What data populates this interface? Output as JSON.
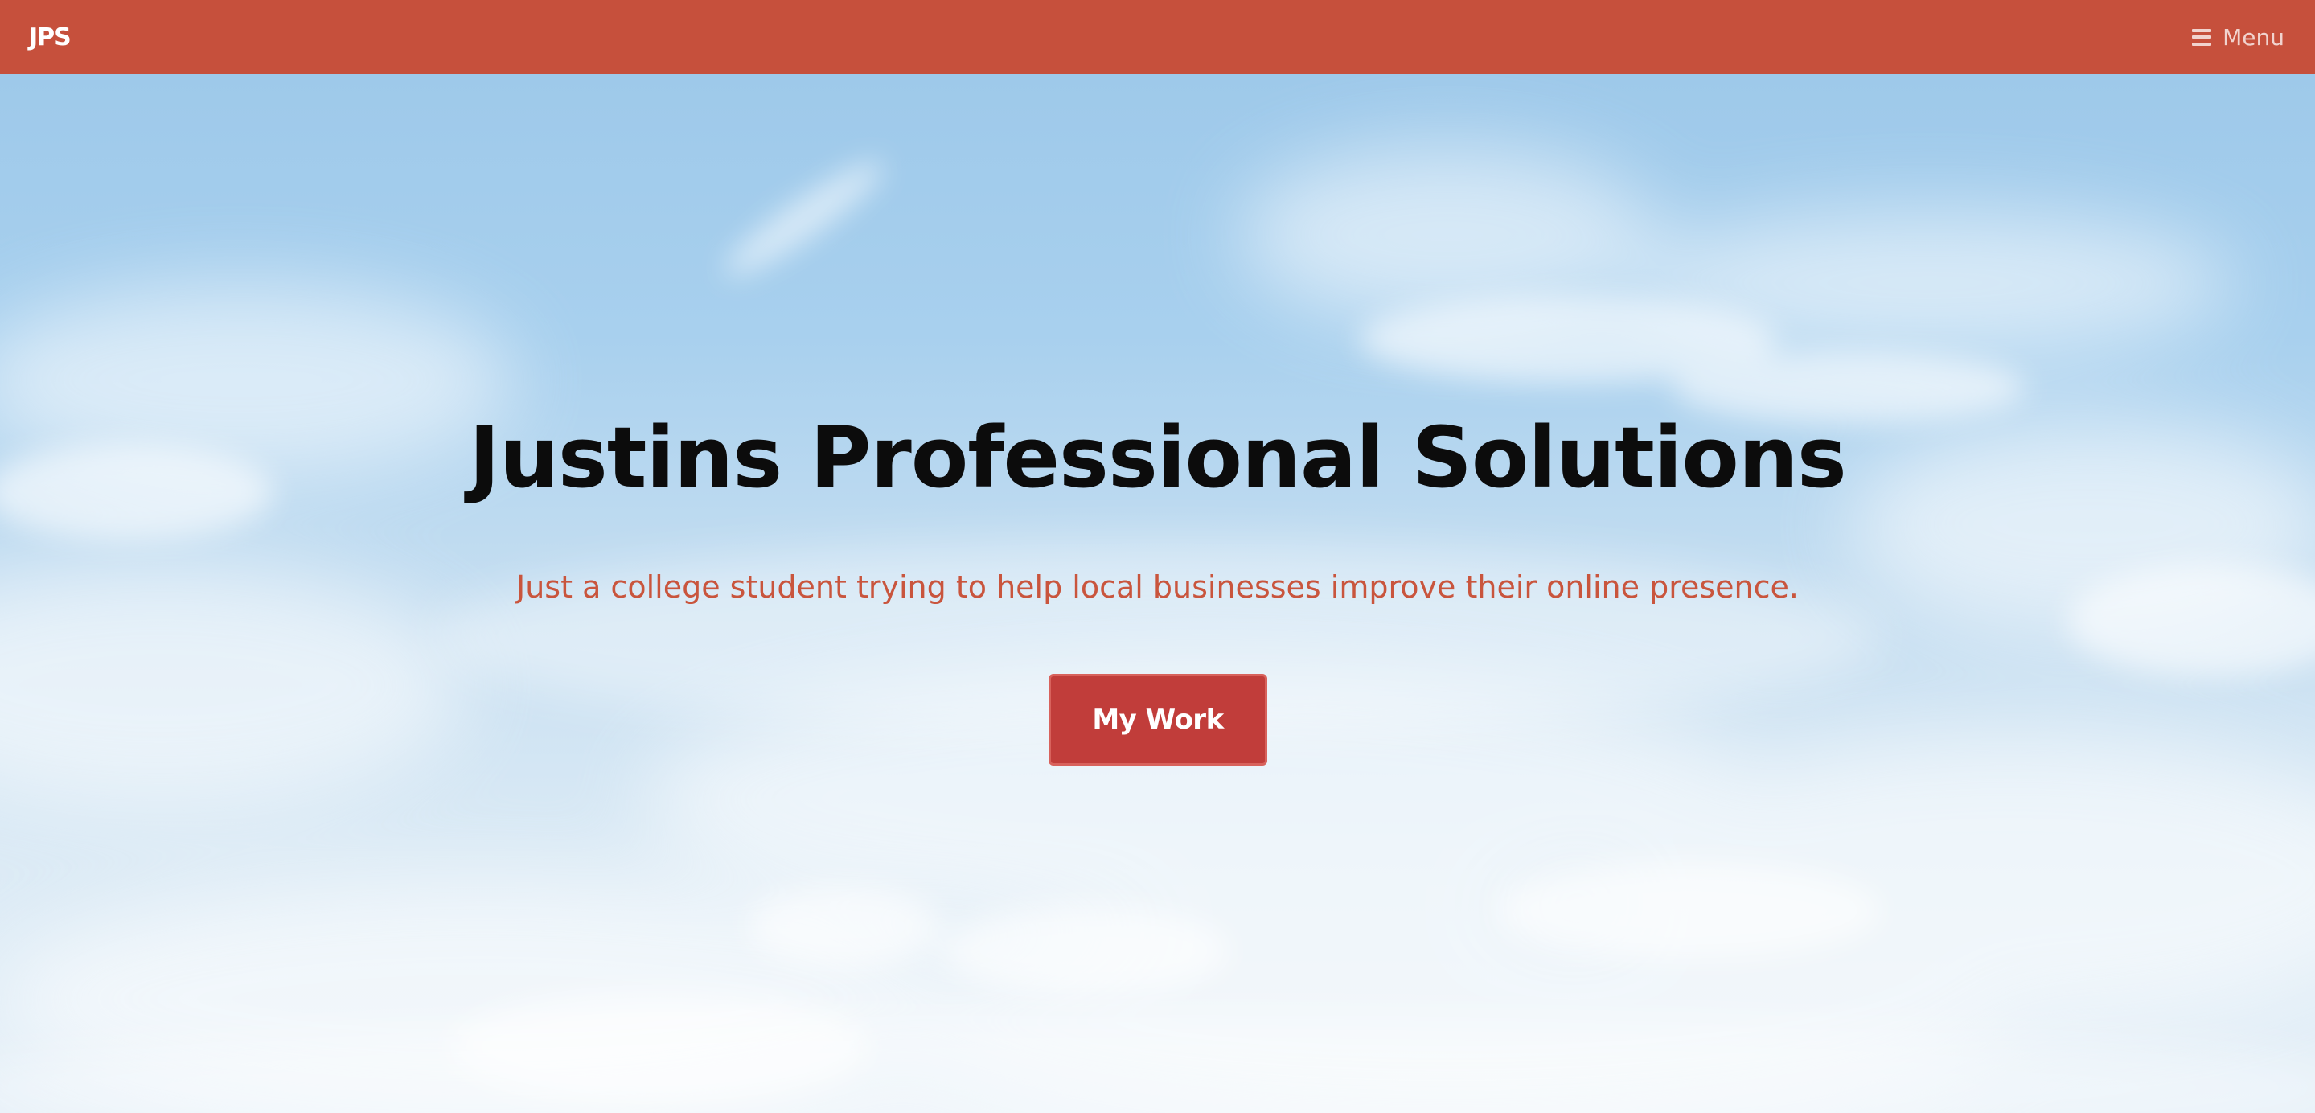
{
  "navbar": {
    "brand": "JPS",
    "menu_label": "Menu",
    "menu_icon": "hamburger-icon",
    "background_color": "#c6503c"
  },
  "hero": {
    "title": "Justins Professional Solutions",
    "subtitle": "Just a college student trying to help local businesses improve their online presence.",
    "cta_label": "My Work",
    "background": "sky-with-clouds",
    "title_color": "#0c0c0c",
    "subtitle_color": "#c9553d",
    "cta_color": "#c13d3a"
  }
}
